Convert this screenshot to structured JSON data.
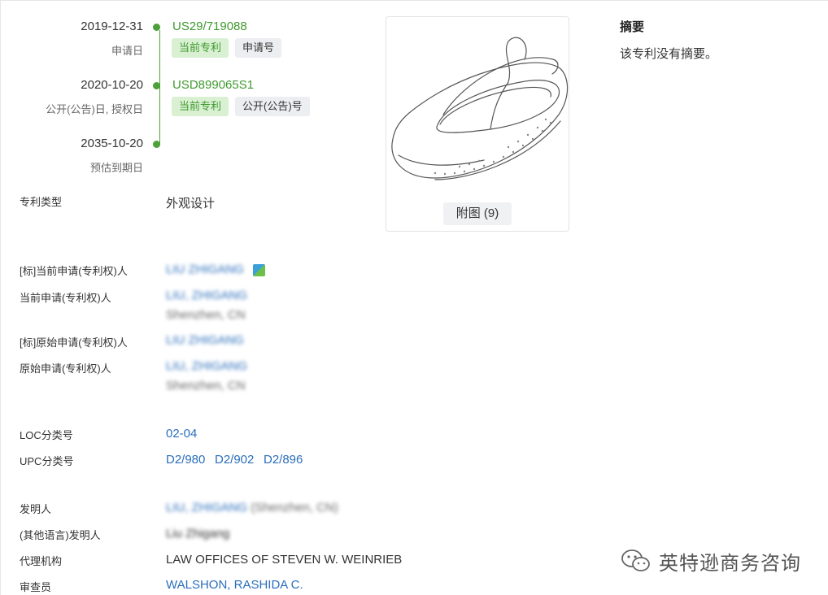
{
  "timeline": [
    {
      "date": "2019-12-31",
      "label": "申请日",
      "number": "US29/719088",
      "tags": [
        "当前专利",
        "申请号"
      ]
    },
    {
      "date": "2020-10-20",
      "label": "公开(公告)日, 授权日",
      "number": "USD899065S1",
      "tags": [
        "当前专利",
        "公开(公告)号"
      ]
    },
    {
      "date": "2035-10-20",
      "label": "预估到期日"
    }
  ],
  "patent_type": {
    "label": "专利类型",
    "value": "外观设计"
  },
  "figure": {
    "button_label": "附图 (9)",
    "image_name": "ballet-shoe-drawing"
  },
  "abstract": {
    "title": "摘要",
    "text": "该专利没有摘要。"
  },
  "fields": {
    "std_current_applicant": {
      "label": "[标]当前申请(专利权)人",
      "value": "LIU ZHIGANG"
    },
    "current_applicant": {
      "label": "当前申请(专利权)人",
      "name": "LIU, ZHIGANG",
      "location": "Shenzhen, CN"
    },
    "std_original_applicant": {
      "label": "[标]原始申请(专利权)人",
      "value": "LIU ZHIGANG"
    },
    "original_applicant": {
      "label": "原始申请(专利权)人",
      "name": "LIU, ZHIGANG",
      "location": "Shenzhen, CN"
    },
    "loc": {
      "label": "LOC分类号",
      "value": "02-04"
    },
    "upc": {
      "label": "UPC分类号",
      "values": [
        "D2/980",
        "D2/902",
        "D2/896"
      ]
    },
    "inventor": {
      "label": "发明人",
      "name": "LIU, ZHIGANG",
      "location": "(Shenzhen, CN)"
    },
    "inventor_other": {
      "label": "(其他语言)发明人",
      "value": "Liu Zhigang"
    },
    "agency": {
      "label": "代理机构",
      "value": "LAW OFFICES OF STEVEN W. WEINRIEB"
    },
    "examiner": {
      "label": "审查员",
      "value": "WALSHON, RASHIDA C."
    }
  },
  "watermark": {
    "text": "英特逊商务咨询",
    "icon": "wechat-icon"
  },
  "colors": {
    "green": "#3f9a2e",
    "link": "#2a6ebb"
  }
}
